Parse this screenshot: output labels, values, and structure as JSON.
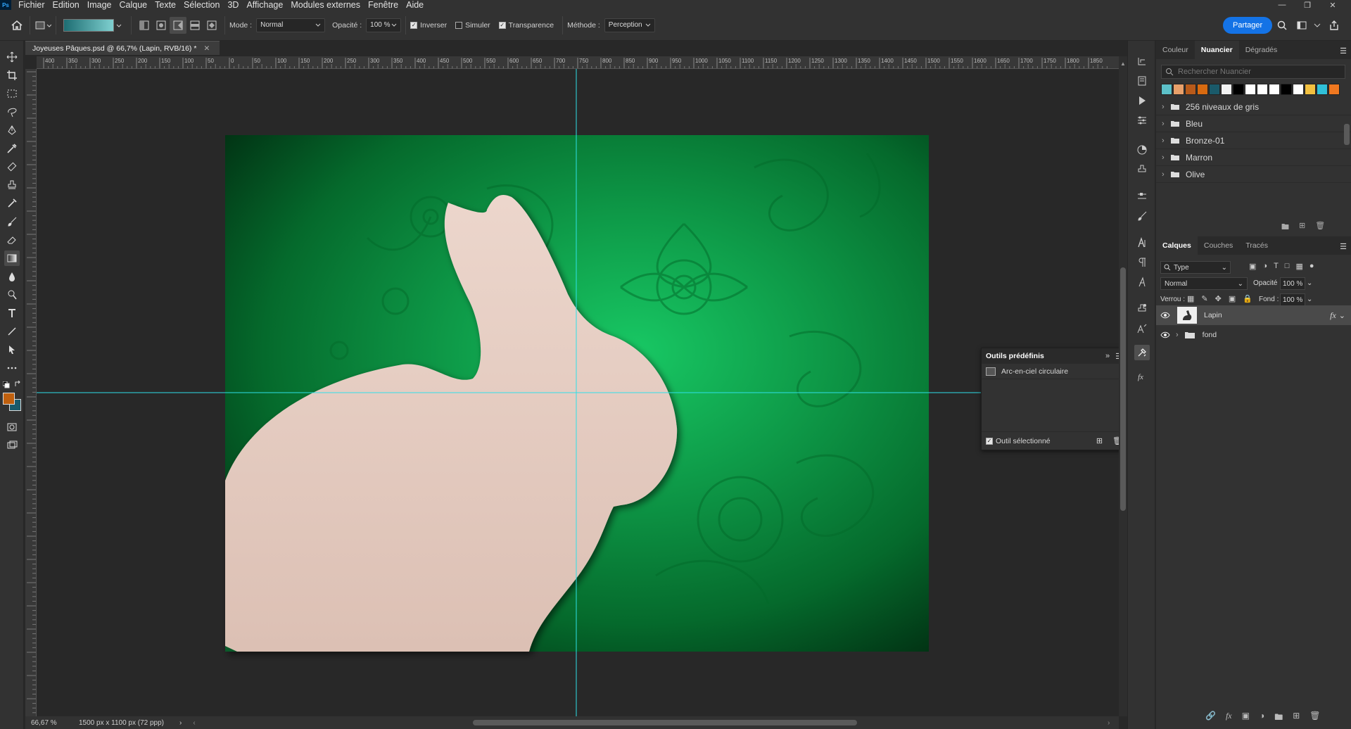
{
  "app": {
    "logo": "Ps"
  },
  "menu": {
    "items": [
      "Fichier",
      "Edition",
      "Image",
      "Calque",
      "Texte",
      "Sélection",
      "3D",
      "Affichage",
      "Modules externes",
      "Fenêtre",
      "Aide"
    ]
  },
  "options": {
    "mode_label": "Mode :",
    "mode_value": "Normal",
    "opacity_label": "Opacité :",
    "opacity_value": "100 %",
    "inverser": {
      "label": "Inverser",
      "checked": true
    },
    "simuler": {
      "label": "Simuler",
      "checked": false
    },
    "transparence": {
      "label": "Transparence",
      "checked": true
    },
    "method_label": "Méthode :",
    "method_value": "Perception",
    "share": "Partager"
  },
  "document": {
    "tab_title": "Joyeuses Pâques.psd @ 66,7% (Lapin, RVB/16) *",
    "zoom": "66,67 %",
    "size_info": "1500 px x 1100 px (72 ppp)"
  },
  "ruler_top": {
    "labels": [
      "400",
      "350",
      "300",
      "250",
      "200",
      "150",
      "100",
      "50",
      "0",
      "50",
      "100",
      "150",
      "200",
      "250",
      "300",
      "350",
      "400",
      "450",
      "500",
      "550",
      "600",
      "650",
      "700",
      "750",
      "800",
      "850",
      "900",
      "950",
      "1000",
      "1050",
      "1100",
      "1150",
      "1200",
      "1250",
      "1300",
      "1350",
      "1400",
      "1450",
      "1500",
      "1550",
      "1600",
      "1650",
      "1700",
      "1750",
      "1800",
      "1850"
    ]
  },
  "swatches": {
    "tabs": [
      "Couleur",
      "Nuancier",
      "Dégradés"
    ],
    "active_tab": "Nuancier",
    "search_placeholder": "Rechercher Nuancier",
    "colors": [
      "#5cc0c8",
      "#e8a06a",
      "#b85a1a",
      "#d86a10",
      "#1a5a6a",
      "#f2f2f2",
      "#000000",
      "#ffffff",
      "#ffffff",
      "#ffffff",
      "#000000",
      "#ffffff",
      "#f2c040",
      "#30c0d8",
      "#f07820"
    ],
    "folders": [
      "256 niveaux de gris",
      "Bleu",
      "Bronze-01",
      "Marron",
      "Olive"
    ]
  },
  "layers_panel": {
    "tabs": [
      "Calques",
      "Couches",
      "Tracés"
    ],
    "active_tab": "Calques",
    "filter": "Type",
    "blend": "Normal",
    "opacity_label": "Opacité :",
    "opacity_value": "100 %",
    "lock_label": "Verrou :",
    "fill_label": "Fond :",
    "fill_value": "100 %",
    "layers": [
      {
        "name": "Lapin",
        "fx": "fx",
        "visible": true,
        "selected": true
      },
      {
        "name": "fond",
        "visible": true,
        "selected": false
      }
    ]
  },
  "presets_panel": {
    "title": "Outils prédéfinis",
    "item": "Arc-en-ciel circulaire",
    "checkbox_label": "Outil sélectionné",
    "checked": true
  },
  "colors": {
    "foreground": "#c0600e",
    "background": "#1a5a6a",
    "guide": "#2ee0e8",
    "accent": "#1473e6"
  }
}
